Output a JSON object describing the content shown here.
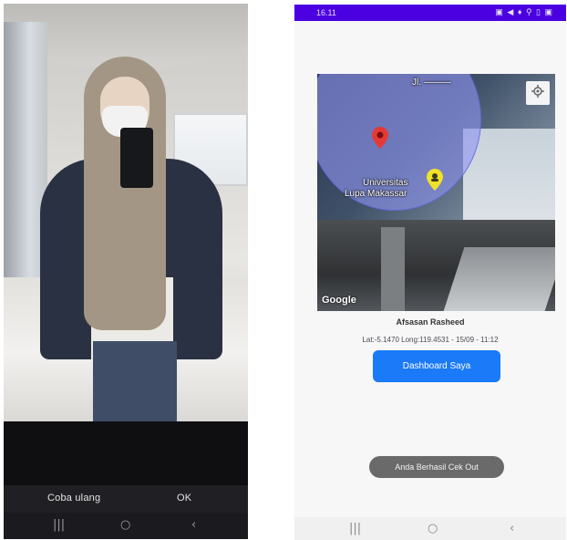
{
  "left_screen": {
    "cancel_label": "Coba ulang",
    "ok_label": "OK",
    "nav": {
      "recents": "|||",
      "home": "○",
      "back": "‹"
    }
  },
  "right_screen": {
    "status_bar": {
      "time": "16.11",
      "icons": "▣ ◀ ♦ ⚲ ▯ ▣"
    },
    "map": {
      "top_label": "Jl. ———",
      "place_label_line1": "Universitas",
      "place_label_line2": "Lupa Makassar",
      "attribution": "Google"
    },
    "name": "Afsasan Rasheed",
    "coordinates": "Lat:-5.1470 Long:119.4531 - 15/09 - 11:12",
    "primary_button_label": "Dashboard Saya",
    "toast": "Anda Berhasil Cek Out",
    "nav": {
      "recents": "|||",
      "home": "○",
      "back": "‹"
    },
    "colors": {
      "status_bar": "#4a00e0",
      "button": "#1a7af8",
      "radius_fill": "#8e94f0"
    }
  }
}
